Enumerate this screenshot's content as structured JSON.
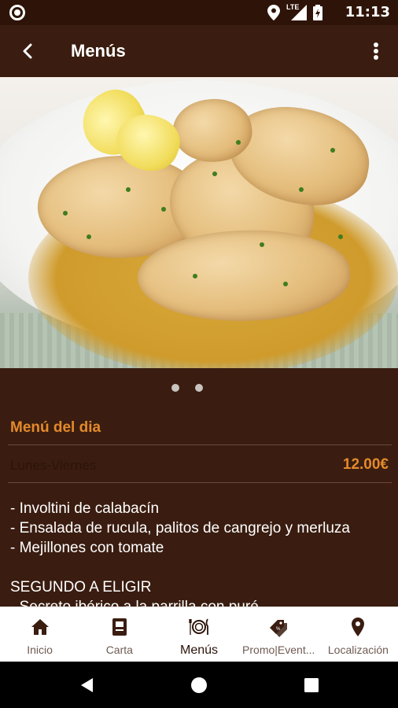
{
  "status_bar": {
    "time": "11:13",
    "network_label": "LTE"
  },
  "app_bar": {
    "title": "Menús"
  },
  "pager": {
    "pages": 3,
    "active_index": 2
  },
  "menu": {
    "title": "Menú del dia",
    "days": "Lunes-Viernes",
    "price": "12.00€",
    "lines": [
      "- Involtini de calabacín",
      "- Ensalada de rucula, palitos de cangrejo y merluza",
      "- Mejillones con tomate",
      "",
      "SEGUNDO A ELIGIR",
      "- Secreto ibérico a la parrilla con puré"
    ]
  },
  "bottom_nav": {
    "items": [
      {
        "label": "Inicio",
        "icon": "home-icon"
      },
      {
        "label": "Carta",
        "icon": "book-icon"
      },
      {
        "label": "Menús",
        "icon": "plate-cutlery-icon",
        "active": true
      },
      {
        "label": "Promo|Event...",
        "icon": "tags-icon"
      },
      {
        "label": "Localización",
        "icon": "location-pin-icon"
      }
    ]
  },
  "colors": {
    "app_bar": "#3a1d10",
    "accent_orange": "#e38a2c",
    "nav_background": "#ffffff"
  }
}
